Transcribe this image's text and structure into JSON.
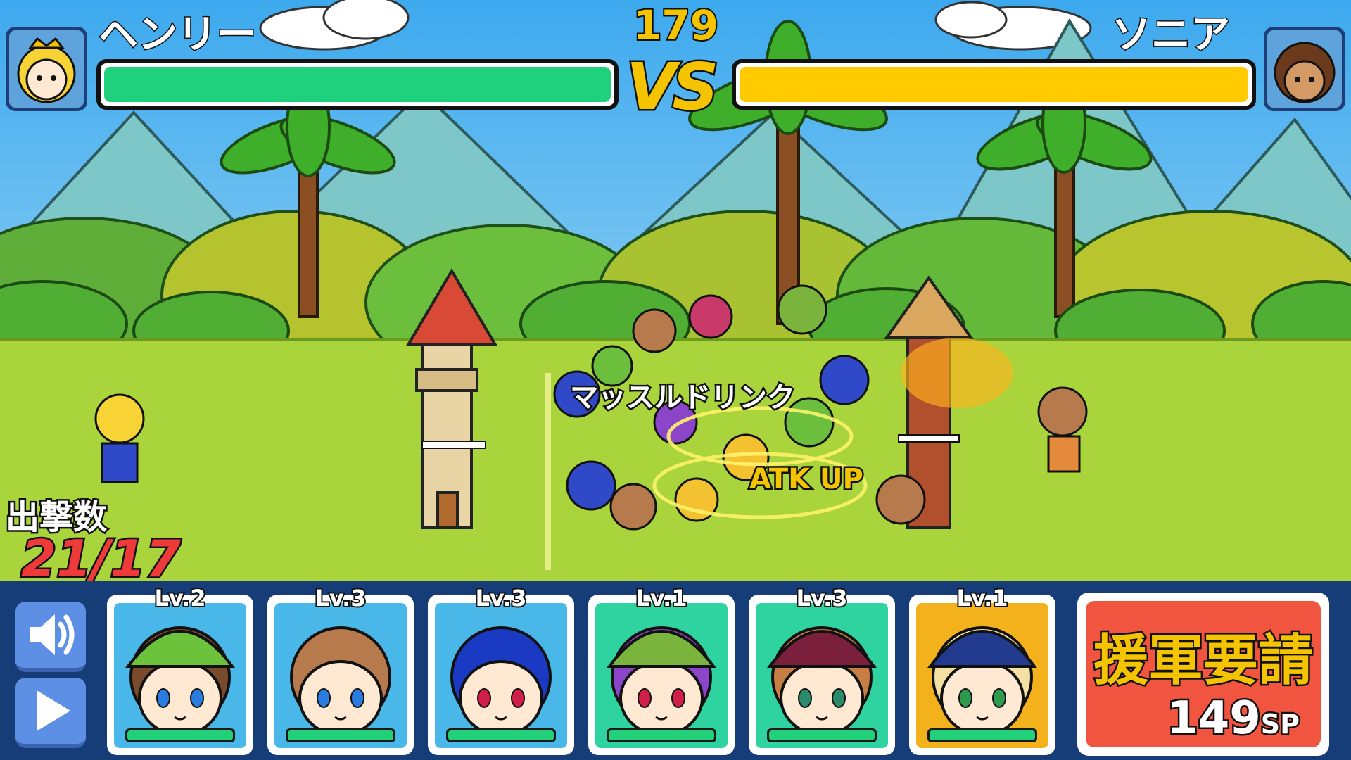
{
  "battle": {
    "timer": "179",
    "vs_label": "VS",
    "player": {
      "name": "ヘンリー",
      "hp": 1.0,
      "hp_color": "#1fd07c"
    },
    "enemy": {
      "name": "ソニア",
      "hp": 1.0,
      "hp_color": "#ffcb00"
    },
    "effects": [
      "マッスルドリンク",
      "ATK UP"
    ]
  },
  "sortie": {
    "label": "出撃数",
    "count": "21/17"
  },
  "controls": {
    "sound_icon": "speaker-icon",
    "play_icon": "play-icon"
  },
  "units": [
    {
      "level": "Lv.2",
      "bg": "#49b7e8",
      "hair": "#7a4a2c",
      "hat": "#6cc23a",
      "skin": "#ffe9d2",
      "eyes": "#2a7de0",
      "hp": 1.0
    },
    {
      "level": "Lv.3",
      "bg": "#49b7e8",
      "hair": "#b67a4c",
      "hat": "",
      "skin": "#ffe9d2",
      "eyes": "#2a7de0",
      "hp": 1.0
    },
    {
      "level": "Lv.3",
      "bg": "#49b7e8",
      "hair": "#1a3ac4",
      "hat": "",
      "skin": "#ffe9d2",
      "eyes": "#d0204a",
      "hp": 1.0
    },
    {
      "level": "Lv.1",
      "bg": "#2fd3a0",
      "hair": "#8a45c9",
      "hat": "#7bb43c",
      "skin": "#ffe9d2",
      "eyes": "#d0204a",
      "hp": 1.0
    },
    {
      "level": "Lv.3",
      "bg": "#2fd3a0",
      "hair": "#c77e44",
      "hat": "#7a1f3c",
      "skin": "#ffe9d2",
      "eyes": "#2a8a6a",
      "hp": 1.0
    },
    {
      "level": "Lv.1",
      "bg": "#f3b21b",
      "hair": "#f4e0a2",
      "hat": "#233b8e",
      "skin": "#ffe9d2",
      "eyes": "#2e9a4e",
      "hp": 1.0
    }
  ],
  "reinforce": {
    "label": "援軍要請",
    "cost": "149",
    "unit": "SP"
  }
}
